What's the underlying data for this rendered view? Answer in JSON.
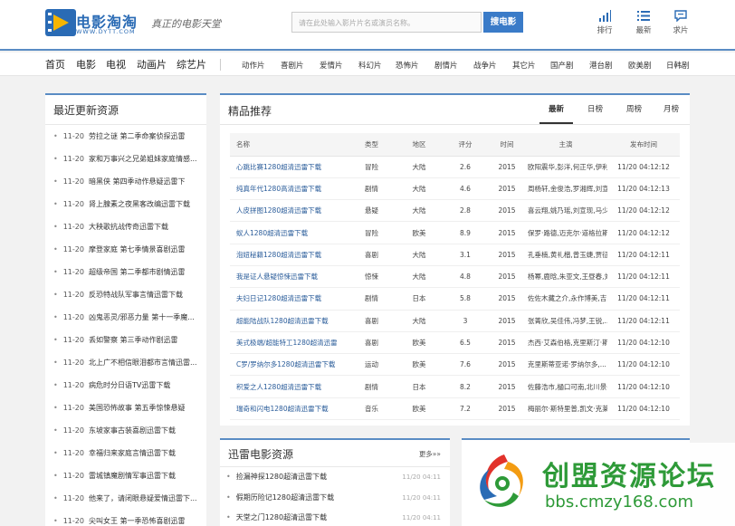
{
  "header": {
    "logo_name": "电影淘淘",
    "logo_url": "WWW.DYTT.COM",
    "slogan": "真正的电影天堂",
    "search_placeholder": "请在此处输入影片片名或演员名称。",
    "search_button": "搜电影",
    "links": [
      {
        "label": "排行",
        "icon": "bar-chart-icon"
      },
      {
        "label": "最新",
        "icon": "list-icon"
      },
      {
        "label": "求片",
        "icon": "message-icon"
      }
    ],
    "accent_color": "#3a7bc8"
  },
  "nav": {
    "main": [
      "首页",
      "电影",
      "电视",
      "动画片",
      "综艺片"
    ],
    "sub": [
      "动作片",
      "喜剧片",
      "爱情片",
      "科幻片",
      "恐怖片",
      "剧情片",
      "战争片",
      "其它片",
      "国产剧",
      "港台剧",
      "欧美剧",
      "日韩剧"
    ]
  },
  "latest": {
    "title": "最近更新资源",
    "items": [
      {
        "date": "11-20",
        "title": "劳拉之谜 第二季命案侦探迅雷"
      },
      {
        "date": "11-20",
        "title": "家和万事兴之兄弟姐妹家庭情感..."
      },
      {
        "date": "11-20",
        "title": "暗黑侠 第四季动作悬疑迅雷下"
      },
      {
        "date": "11-20",
        "title": "肾上腺素之夜黑客改编迅雷下载"
      },
      {
        "date": "11-20",
        "title": "大秧歌抗战传奇迅雷下载"
      },
      {
        "date": "11-20",
        "title": "摩登家庭 第七季情景喜剧迅雷"
      },
      {
        "date": "11-20",
        "title": "超级帝国 第二季都市剧情迅雷"
      },
      {
        "date": "11-20",
        "title": "反恐特战队军事言情迅雷下载"
      },
      {
        "date": "11-20",
        "title": "凶鬼恶灵/邪恶力量 第十一季魔..."
      },
      {
        "date": "11-20",
        "title": "丢如警察 第三季动作剧迅雷"
      },
      {
        "date": "11-20",
        "title": "北上广不相信眼泪都市言情迅雷..."
      },
      {
        "date": "11-20",
        "title": "病危时分日语TV迅雷下载"
      },
      {
        "date": "11-20",
        "title": "美国恐怖故事 第五季惊悚悬疑"
      },
      {
        "date": "11-20",
        "title": "东坡家事古装喜剧迅雷下载"
      },
      {
        "date": "11-20",
        "title": "幸福归来家庭言情迅雷下载"
      },
      {
        "date": "11-20",
        "title": "雷城镇魔剧情军事迅雷下载"
      },
      {
        "date": "11-20",
        "title": "他来了，请闭眼悬疑爱情迅雷下..."
      },
      {
        "date": "11-20",
        "title": "尖叫女王 第一季恐怖喜剧迅雷"
      }
    ]
  },
  "featured": {
    "title": "精品推荐",
    "tabs": [
      "最新",
      "日榜",
      "周榜",
      "月榜"
    ],
    "active_tab": "最新",
    "columns": [
      "名称",
      "类型",
      "地区",
      "评分",
      "时间",
      "主演",
      "发布时间"
    ],
    "rows": [
      [
        "心跳比赛1280超清迅雷下载",
        "冒险",
        "大陆",
        "2.6",
        "2015",
        "欧阳震华,彭洋,何正华,伊利亚尔,...",
        "11/20 04:12:12"
      ],
      [
        "纯真年代1280高清迅雷下载",
        "剧情",
        "大陆",
        "4.6",
        "2015",
        "周杨轩,金俊浩,罗湘辉,刘宣迪,严...",
        "11/20 04:12:13"
      ],
      [
        "人皮拼图1280超清迅雷下载",
        "悬疑",
        "大陆",
        "2.8",
        "2015",
        "喜云翔,姚乃瑶,刘宣现,马少骅,...",
        "11/20 04:12:12"
      ],
      [
        "蚁人1280超清迅雷下载",
        "冒险",
        "欧美",
        "8.9",
        "2015",
        "保罗·路德,迈克尔·道格拉斯,伊万...",
        "11/20 04:12:12"
      ],
      [
        "泡妞秘籍1280超清迅雷下载",
        "喜剧",
        "大陆",
        "3.1",
        "2015",
        "孔垂楠,黄礼楷,曾玉婕,贾征宇,李...",
        "11/20 04:12:11"
      ],
      [
        "我是证人悬疑惊悚迅雷下载",
        "惊悚",
        "大陆",
        "4.8",
        "2015",
        "杨幂,鹿晗,朱亚文,王昼春,刘芮麟,...",
        "11/20 04:12:11"
      ],
      [
        "夫妇日记1280超清迅雷下载",
        "剧情",
        "日本",
        "5.8",
        "2015",
        "佐佐木藏之介,永作博美,吉田羊,仁...",
        "11/20 04:12:11"
      ],
      [
        "超能陆战队1280超清迅雷下载",
        "喜剧",
        "大陆",
        "3",
        "2015",
        "张菁欣,吴佳伟,冯梦,王锐,...",
        "11/20 04:12:11"
      ],
      [
        "美式极端/超能特工1280超清迅雷",
        "喜剧",
        "欧美",
        "6.5",
        "2015",
        "杰西·艾森伯格,克里斯汀·斯图尔...",
        "11/20 04:12:10"
      ],
      [
        "C罗/罗纳尔多1280超清迅雷下载",
        "运动",
        "欧美",
        "7.6",
        "2015",
        "克里斯蒂亚诺·罗纳尔多,...",
        "11/20 04:12:10"
      ],
      [
        "积爱之人1280超清迅雷下载",
        "剧情",
        "日本",
        "8.2",
        "2015",
        "佐藤浩市,樋口可南,北川景子,野村周...",
        "11/20 04:12:10"
      ],
      [
        "瑞奇和闪电1280超清迅雷下载",
        "音乐",
        "欧美",
        "7.2",
        "2015",
        "梅丽尔·斯特里普,凯文·克莱恩,麦...",
        "11/20 04:12:10"
      ]
    ]
  },
  "thunder": {
    "title": "迅雷电影资源",
    "more": "更多»»",
    "items": [
      {
        "title": "捡漏神探1280超清迅雷下载",
        "date": "11/20 04:11"
      },
      {
        "title": "假期历险记1280超清迅雷下载",
        "date": "11/20 04:11"
      },
      {
        "title": "天堂之门1280超清迅雷下载",
        "date": "11/20 04:11"
      }
    ]
  },
  "watermark": {
    "title": "创盟资源论坛",
    "url": "bbs.cmzy168.com"
  }
}
